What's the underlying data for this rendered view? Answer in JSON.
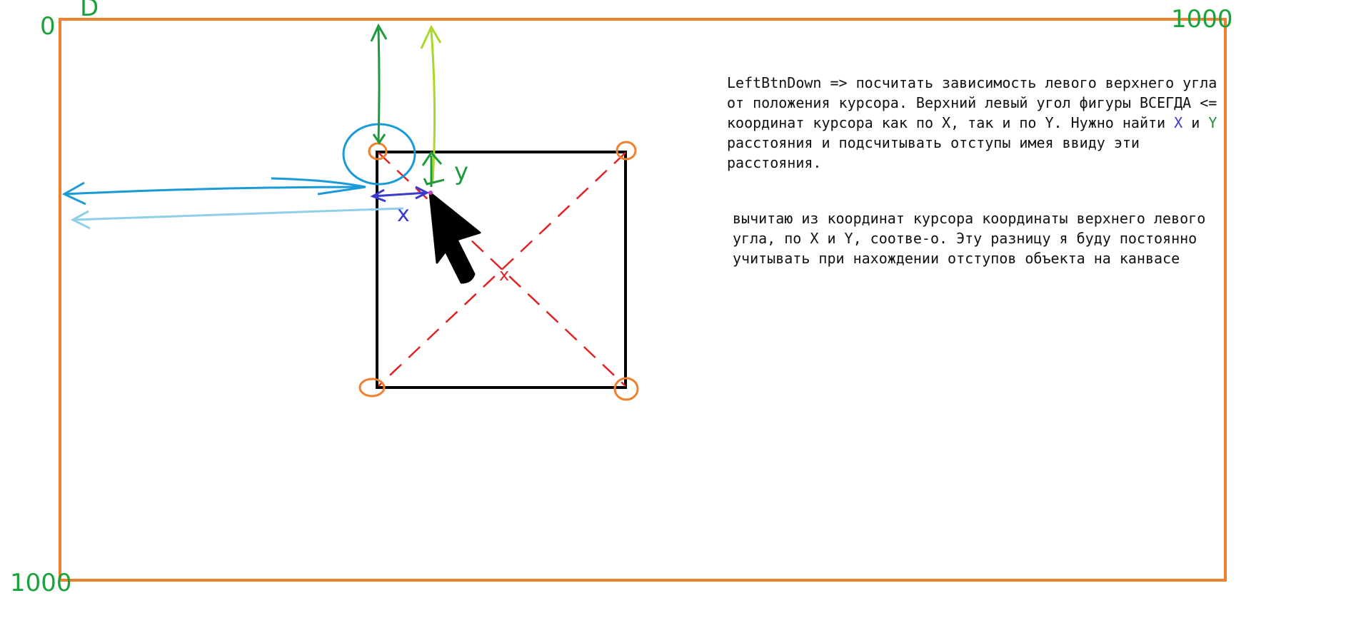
{
  "labels": {
    "origin_top_left": "0",
    "origin_top_small": "D",
    "max_top_right": "1000",
    "max_bottom_left": "1000",
    "offset_y": "y",
    "offset_x": "x",
    "center_mark": "x"
  },
  "note_1": {
    "text_before": "LeftBtnDown => посчитать зависимость левого верхнего угла от положения курсора. Верхний левый угол фигуры ВСЕГДА <= координат курсора как по X, так и по Y. Нужно найти ",
    "x_letter": "X",
    "conj": " и ",
    "y_letter": "Y",
    "text_after": " расстояния и подсчитывать отступы имея ввиду эти расстояния."
  },
  "note_2": {
    "text": "вычитаю из координат курсора координаты верхнего левого угла, по X и Y, соотве-о. Эту разницу я буду постоянно учитывать при нахождении отступов объекта на канвасе"
  },
  "colors": {
    "canvas_border": "#f07f2e",
    "figure_border": "#000000",
    "diagonal": "#e02222",
    "label_green": "#1aa33a",
    "arrow_blue": "#1a9ad8",
    "arrow_light_blue": "#8fd0e8",
    "arrow_lime": "#a8d829",
    "x_blue": "#3a3ad0"
  }
}
